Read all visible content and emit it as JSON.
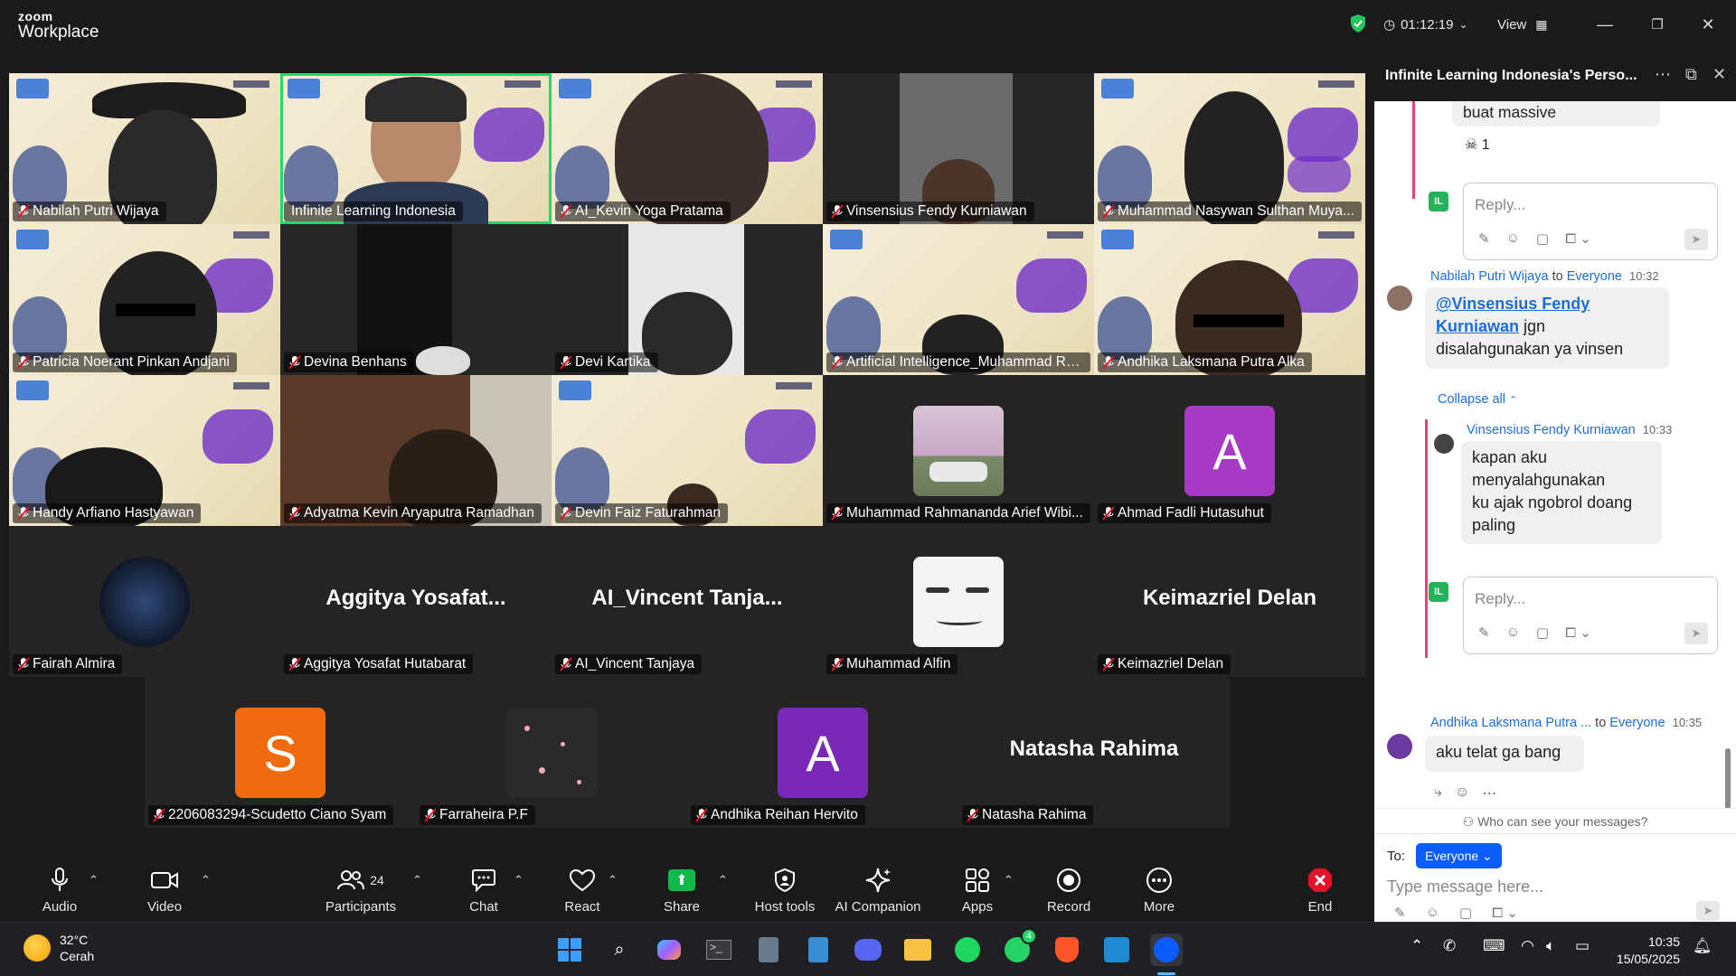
{
  "window": {
    "brand_small": "zoom",
    "brand_large": "Workplace",
    "timer": "01:12:19",
    "view_label": "View"
  },
  "colors": {
    "accent_green": "#23d96b",
    "brand_blue": "#0b5cff",
    "end_red": "#e5102a",
    "chat_link": "#1a6fd6",
    "thread_pink": "#e3437a"
  },
  "gallery": {
    "tiles": [
      {
        "name": "Nabilah Putri Wijaya",
        "muted": true
      },
      {
        "name": "Infinite Learning Indonesia",
        "muted": false,
        "active": true
      },
      {
        "name": "AI_Kevin Yoga Pratama",
        "muted": true
      },
      {
        "name": "Vinsensius Fendy Kurniawan",
        "muted": true
      },
      {
        "name": "Muhammad Nasywan Sulthan Muya...",
        "muted": true
      },
      {
        "name": "Patricia Noerant Pinkan Andjani",
        "muted": true
      },
      {
        "name": "Devina Benhans",
        "muted": true
      },
      {
        "name": "Devi Kartika",
        "muted": true
      },
      {
        "name": "Artificial Intelligence_Muhammad Ra...",
        "muted": true
      },
      {
        "name": "Andhika Laksmana Putra Alka",
        "muted": true
      },
      {
        "name": "Handy Arfiano Hastyawan",
        "muted": true
      },
      {
        "name": "Adyatma Kevin Aryaputra Ramadhan",
        "muted": true
      },
      {
        "name": "Devin Faiz Faturahman",
        "muted": true
      },
      {
        "name": "Muhammad Rahmananda Arief Wibi...",
        "muted": true
      },
      {
        "name": "Ahmad Fadli Hutasuhut",
        "muted": true,
        "letter": "A"
      },
      {
        "name": "Fairah Almira",
        "muted": true
      },
      {
        "name": "Aggitya Yosafat Hutabarat",
        "muted": true,
        "big": "Aggitya  Yosafat..."
      },
      {
        "name": "AI_Vincent Tanjaya",
        "muted": true,
        "big": "AI_Vincent  Tanja..."
      },
      {
        "name": "Muhammad Alfin",
        "muted": true
      },
      {
        "name": "Keimazriel Delan",
        "muted": true,
        "big": "Keimazriel Delan"
      },
      {
        "name": "2206083294-Scudetto Ciano Syam",
        "muted": true,
        "letter": "S"
      },
      {
        "name": "Farraheira P.F",
        "muted": true
      },
      {
        "name": "Andhika Reihan Hervito",
        "muted": true,
        "letter": "A"
      },
      {
        "name": "Natasha Rahima",
        "muted": true,
        "big": "Natasha Rahima"
      }
    ]
  },
  "chat": {
    "title": "Infinite Learning Indonesia's Perso...",
    "msg_top_text": "buat massive",
    "reaction_count": "1",
    "reply_placeholder": "Reply...",
    "msg1": {
      "sender": "Nabilah Putri Wijaya",
      "to_word": "to",
      "to": "Everyone",
      "time": "10:32",
      "mention": "@Vinsensius Fendy Kurniawan",
      "text_after_mention": " jgn",
      "line2": "disalahgunakan ya vinsen"
    },
    "collapse_label": "Collapse all",
    "msg2": {
      "sender": "Vinsensius Fendy Kurniawan",
      "time": "10:33",
      "lines": [
        "kapan aku",
        "menyalahgunakan",
        "ku ajak ngobrol doang",
        "paling"
      ]
    },
    "msg3": {
      "sender": "Andhika Laksmana Putra ...",
      "to_word": "to",
      "to": "Everyone",
      "time": "10:35",
      "text": "aku telat ga bang"
    },
    "who_can_see": "Who can see your messages?",
    "to_label": "To:",
    "recipient": "Everyone",
    "compose_placeholder": "Type message here...",
    "il_badge": "IL"
  },
  "toolbar": {
    "audio": "Audio",
    "video": "Video",
    "participants": "Participants",
    "participants_count": "24",
    "chat": "Chat",
    "react": "React",
    "share": "Share",
    "host_tools": "Host tools",
    "ai_companion": "AI Companion",
    "apps": "Apps",
    "record": "Record",
    "more": "More",
    "end": "End"
  },
  "taskbar": {
    "temp": "32°C",
    "weather": "Cerah",
    "time": "10:35",
    "date": "15/05/2025",
    "whatsapp_badge": "4"
  }
}
